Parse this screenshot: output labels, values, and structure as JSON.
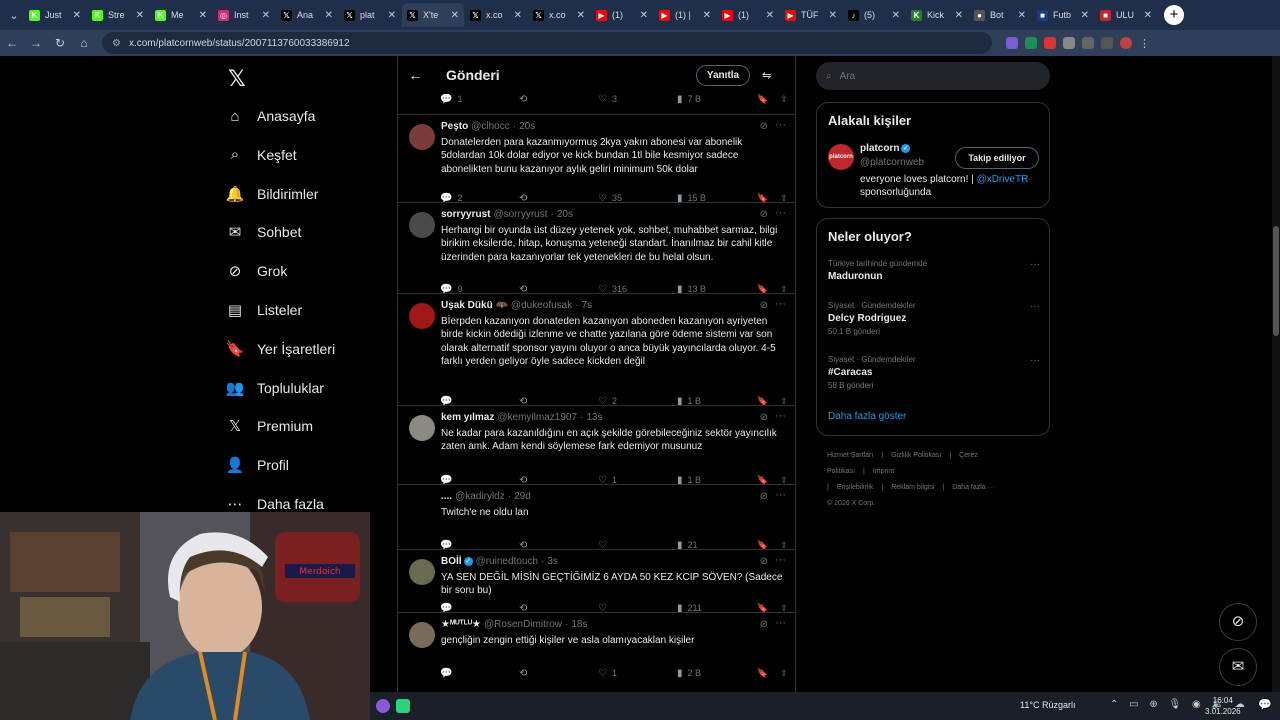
{
  "browser": {
    "tabs": [
      {
        "label": "Just",
        "icon": "kick-icon",
        "color": "#53fc18"
      },
      {
        "label": "Stre",
        "icon": "kick-icon",
        "color": "#53fc18"
      },
      {
        "label": "Me",
        "icon": "kick-icon",
        "color": "#53fc18"
      },
      {
        "label": "Inst",
        "icon": "instagram-icon",
        "color": "#d62976"
      },
      {
        "label": "Ana",
        "icon": "x-icon",
        "color": "#000000"
      },
      {
        "label": "plat",
        "icon": "x-icon",
        "color": "#000000"
      },
      {
        "label": "X'te",
        "icon": "x-icon",
        "color": "#000000"
      },
      {
        "label": "x.co",
        "icon": "x-icon",
        "color": "#000000"
      },
      {
        "label": "x.co",
        "icon": "x-icon",
        "color": "#000000"
      },
      {
        "label": "(1)",
        "icon": "youtube-icon",
        "color": "#ff0000"
      },
      {
        "label": "(1) |",
        "icon": "youtube-icon",
        "color": "#ff0000"
      },
      {
        "label": "(1)",
        "icon": "youtube-icon",
        "color": "#ff0000"
      },
      {
        "label": "TÜF",
        "icon": "youtube-icon",
        "color": "#ff0000"
      },
      {
        "label": "(5)",
        "icon": "tiktok-icon",
        "color": "#000000"
      },
      {
        "label": "Kick",
        "icon": "kick-site-icon",
        "color": "#2a7d2a"
      },
      {
        "label": "Bot",
        "icon": "bot-icon",
        "color": "#555555"
      },
      {
        "label": "Futb",
        "icon": "site-icon",
        "color": "#1a3a8a"
      },
      {
        "label": "ULU",
        "icon": "site-icon",
        "color": "#c0262d"
      }
    ],
    "active_tab": 6,
    "url": "x.com/platcornweb/status/2007113760033386912"
  },
  "nav": {
    "items": [
      {
        "label": "Anasayfa",
        "icon": "home-icon"
      },
      {
        "label": "Keşfet",
        "icon": "search-icon"
      },
      {
        "label": "Bildirimler",
        "icon": "bell-icon"
      },
      {
        "label": "Sohbet",
        "icon": "mail-icon"
      },
      {
        "label": "Grok",
        "icon": "grok-icon"
      },
      {
        "label": "Listeler",
        "icon": "list-icon"
      },
      {
        "label": "Yer İşaretleri",
        "icon": "bookmark-icon"
      },
      {
        "label": "Topluluklar",
        "icon": "people-icon"
      },
      {
        "label": "Premium",
        "icon": "x-icon"
      },
      {
        "label": "Profil",
        "icon": "person-icon"
      },
      {
        "label": "Daha fazla",
        "icon": "more-circle-icon"
      }
    ]
  },
  "feed": {
    "title": "Gönderi",
    "reply_button": "Yanıtla",
    "top_actions": {
      "replies": "1",
      "reposts": "",
      "likes": "3",
      "views": "7 B"
    },
    "tweets": [
      {
        "name": "Peşto",
        "handle": "@clhocc",
        "time": "20s",
        "verified": false,
        "avatar_color": "#7a3b3b",
        "text": "Donatelerden para kazanmıyormuş 2kya yakın abonesi var abonelik 5dolardan 10k dolar ediyor ve kick bundan 1tl bile kesmiyor sadece abonelikten bunu kazanıyor aylık geliri minimum 50k dolar",
        "replies": "2",
        "reposts": "",
        "likes": "35",
        "views": "15 B"
      },
      {
        "name": "sorryyrust",
        "handle": "@sorryyrust",
        "time": "20s",
        "verified": false,
        "avatar_color": "#4a4a4a",
        "text": "Herhangi bir oyunda üst düzey yetenek yok, sohbet, muhabbet sarmaz, bilgi birikim eksilerde, hitap, konuşma yeteneği standart. İnanılmaz bir cahil kitle üzerinden para kazanıyorlar tek yetenekleri de bu helal olsun.",
        "replies": "9",
        "reposts": "",
        "likes": "316",
        "views": "13 B"
      },
      {
        "name": "Uşak Dükü 🦇",
        "handle": "@dukeofusak",
        "time": "7s",
        "verified": false,
        "avatar_color": "#a01818",
        "text": "Bİerpden kazanıyon donateden kazanıyon aboneden kazanıyon ayriyeten birde kickin ödediği izlenme ve chatte yazılana göre ödeme sistemi var son olarak alternatif sponsor yayını oluyor o anca büyük yayıncılarda oluyor. 4-5 farklı yerden geliyor öyle sadece kickden değil",
        "replies": "",
        "reposts": "",
        "likes": "2",
        "views": "1 B"
      },
      {
        "name": "kem yılmaz",
        "handle": "@kemyilmaz1907",
        "time": "13s",
        "verified": false,
        "avatar_color": "#8a8a80",
        "text": "Ne kadar para kazanıldığını en açık şekilde görebileceğiniz sektör yayıncılık zaten amk. Adam kendi söylemese fark edemiyor musunuz",
        "replies": "",
        "reposts": "",
        "likes": "1",
        "views": "1 B"
      },
      {
        "name": "....",
        "handle": "@kadiryldz",
        "time": "29d",
        "verified": false,
        "avatar_color": "#000000",
        "text": "Twitch'e ne oldu lan",
        "replies": "",
        "reposts": "",
        "likes": "",
        "views": "21"
      },
      {
        "name": "BOİİ",
        "handle": "@ruinedtouch",
        "time": "3s",
        "verified": true,
        "avatar_color": "#6a6a50",
        "text": "YA SEN DEĞİL MİSİN GEÇTİĞİMİZ 6 AYDA 50 KEZ KCIP SÖVEN? (Sadece bir soru bu)",
        "replies": "",
        "reposts": "",
        "likes": "",
        "views": "211"
      },
      {
        "name": "★ᴹᵁᵀᴸᵁ★",
        "handle": "@RosenDimitrow",
        "time": "18s",
        "verified": false,
        "avatar_color": "#7a6a5a",
        "text": "gençliğin zengin ettiği kişiler ve asla olamıyacaklan kişiler",
        "replies": "",
        "reposts": "",
        "likes": "1",
        "views": "2 B"
      }
    ]
  },
  "sidebar": {
    "search_placeholder": "Ara",
    "related_title": "Alakalı kişiler",
    "related": {
      "name": "platcorn",
      "handle": "@platcornweb",
      "avatar_text": "platcorn",
      "follow_label": "Takip ediliyor",
      "bio": "everyone loves platcorn! | ",
      "bio_link": "@xDriveTR",
      "bio_end": "sponsorluğunda"
    },
    "trends_title": "Neler oluyor?",
    "trends": [
      {
        "context": "Türkiye tarihinde gündemde",
        "name": "Maduronun",
        "count": ""
      },
      {
        "context": "Siyaset · Gündemdekiler",
        "name": "Delcy Rodriguez",
        "count": "50,1 B gönderi"
      },
      {
        "context": "Siyaset · Gündemdekiler",
        "name": "#Caracas",
        "count": "58 B gönderi"
      }
    ],
    "show_more": "Daha fazla göster",
    "footer": [
      "Hizmet Şartları",
      "|",
      "Gizlilik Politikası",
      "|",
      "Çerez Politikası",
      "|",
      "Imprint",
      "|",
      "Erişilebilirlik",
      "|",
      "Reklam bilgisi",
      "|",
      "Daha fazla ···",
      "© 2026 X Corp."
    ]
  },
  "webcam": {
    "sign_text": "Merdoich"
  },
  "taskbar": {
    "weather": "11°C Rüzgarlı",
    "time": "16:04",
    "date": "3.01.2026"
  }
}
